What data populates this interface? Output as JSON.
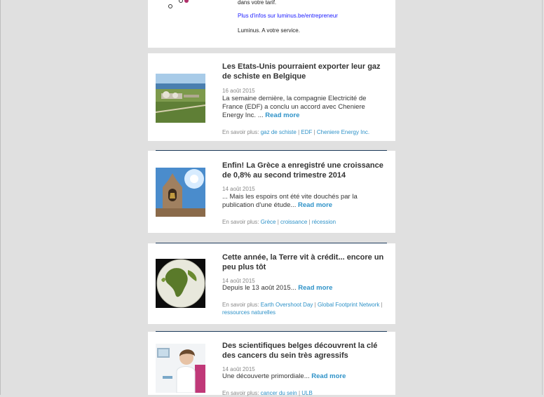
{
  "ad": {
    "line1": "dans votre tarif.",
    "link": "Plus d'infos sur luminus.be/entrepreneur",
    "slogan": "Luminus. A votre service."
  },
  "articles": [
    {
      "title": "Les Etats-Unis pourraient exporter leur gaz de schiste en Belgique",
      "date": "16 août 2015",
      "excerpt": "La semaine dernière, la compagnie Electricité de France (EDF) a conclu un accord avec Cheniere Energy Inc. ...",
      "read_more": "Read more",
      "tags_label": "En savoir plus:",
      "tags": [
        "gaz de schiste",
        "EDF",
        "Cheniere Energy Inc."
      ],
      "image_icon": "gas-terminal-photo"
    },
    {
      "title": "Enfin! La Grèce a enregistré une croissance de 0,8% au second trimestre 2014",
      "date": "14 août 2015",
      "excerpt": "... Mais les espoirs ont été vite douchés par la publication d'une étude...",
      "read_more": "Read more",
      "tags_label": "En savoir plus:",
      "tags": [
        "Grèce",
        "croissance",
        "récession"
      ],
      "image_icon": "greek-bell-tower-photo"
    },
    {
      "title": "Cette année, la Terre vit à crédit... encore un peu plus tôt",
      "date": "14 août 2015",
      "excerpt": "Depuis le 13 août 2015...",
      "read_more": "Read more",
      "tags_label": "En savoir plus:",
      "tags": [
        "Earth Overshoot Day",
        "Global Footprint Network",
        "ressources naturelles"
      ],
      "image_icon": "earth-globe-photo"
    },
    {
      "title": "Des scientifiques belges découvrent la clé des cancers du sein très agressifs",
      "date": "14 août 2015",
      "excerpt": "Une découverte primordiale...",
      "read_more": "Read more",
      "tags_label": "En savoir plus:",
      "tags": [
        "cancer du sein",
        "ULB"
      ],
      "image_icon": "lab-scientist-photo"
    }
  ],
  "colors": {
    "link": "#2e92c8",
    "separator": "#1c3a5a",
    "background": "#e0e0e0"
  }
}
